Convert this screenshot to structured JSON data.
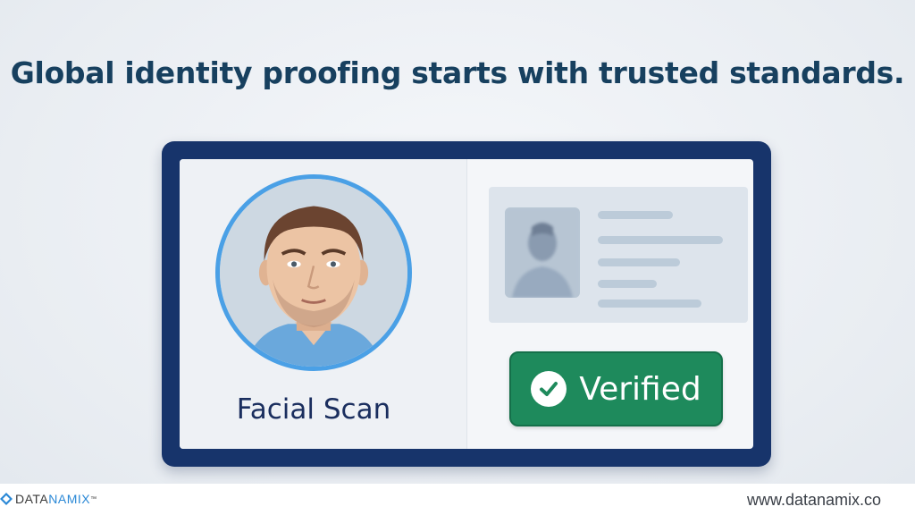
{
  "headline": "Global identity proofing starts with trusted standards.",
  "card": {
    "left_label": "Facial Scan",
    "status_label": "Verified",
    "status_color": "#1e8a5c",
    "frame_color": "#17346b",
    "portrait_border_color": "#4aa0e6"
  },
  "footer": {
    "logo_part1": "DATA",
    "logo_part2": "NAMIX",
    "logo_tm": "™",
    "url": "www.datanamix.co"
  },
  "icons": {
    "verified": "check-circle-icon",
    "portrait": "face-portrait",
    "id_photo": "id-photo-silhouette",
    "logo": "diamond-logo-icon"
  }
}
